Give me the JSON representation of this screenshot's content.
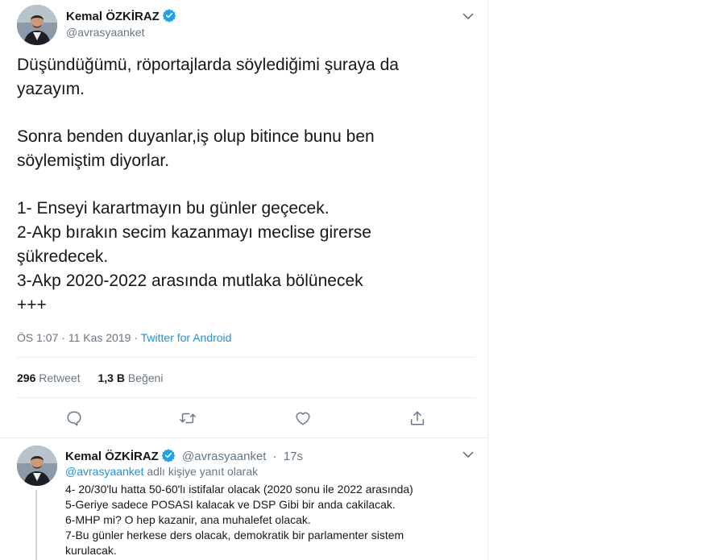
{
  "main_tweet": {
    "author_name": "Kemal ÖZKİRAZ",
    "handle": "@avrasyaanket",
    "text_lines": [
      "Düşündüğümü, röportajlarda söylediğimi şuraya da",
      "yazayım.",
      "",
      "Sonra benden duyanlar,iş olup bitince bunu ben",
      "söylemiştim diyorlar.",
      "",
      "1- Enseyi karartmayın bu günler geçecek.",
      "2-Akp bırakın secim kazanmayı meclise girerse",
      "şükredecek.",
      "3-Akp 2020-2022 arasında mutlaka bölünecek",
      "+++"
    ],
    "time": "ÖS 1:07",
    "date": "11 Kas 2019",
    "dot": "·",
    "source": "Twitter for Android",
    "retweet_count": "296",
    "retweet_label": "Retweet",
    "like_count": "1,3 B",
    "like_label": "Beğeni"
  },
  "reply_tweet": {
    "author_name": "Kemal ÖZKİRAZ",
    "handle": "@avrasyaanket",
    "dot": "·",
    "time_ago": "17s",
    "replying_to_handle": "@avrasyaanket",
    "replying_suffix": "adlı kişiye yanıt olarak",
    "lines": [
      "4- 20/30'lu hatta 50-60'lı istifalar olacak (2020 sonu ile 2022 arasında)",
      "5-Geriye sadece POSASI kalacak ve DSP Gibi bir anda cakilacak.",
      "6-MHP mi? O hep kazanir, ana muhalefet olacak.",
      "7-Bu günler herkese ders olacak, demokratik bir parlamenter sistem",
      "kurulacak."
    ]
  },
  "icons": {
    "verified": "verified-badge-icon",
    "caret": "chevron-down-icon",
    "reply": "reply-icon",
    "retweet": "retweet-icon",
    "like": "heart-icon",
    "share": "share-icon"
  },
  "colors": {
    "link": "#1b95e0",
    "verified": "#1da1f2",
    "muted": "#657786",
    "text": "#14171a"
  }
}
